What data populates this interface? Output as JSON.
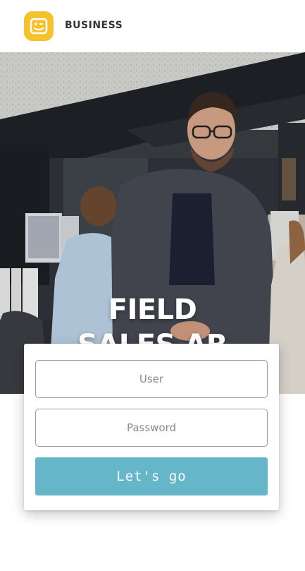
{
  "header": {
    "logo_icon": "smiley-icon",
    "logo_color": "#f5c22b",
    "brand": "BUSINESS"
  },
  "hero": {
    "title_line1": "FIELD",
    "title_line2": "SALES AR"
  },
  "login": {
    "user_placeholder": "User",
    "password_placeholder": "Password",
    "submit_label": "Let's go",
    "button_color": "#66b6ca"
  }
}
